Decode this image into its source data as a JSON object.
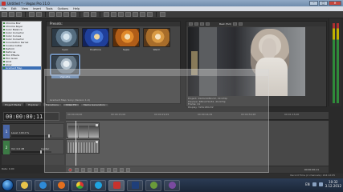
{
  "window": {
    "title": "Untitled * - Vegas Pro 11.0",
    "minimize": "–",
    "maximize": "□",
    "close": "✕"
  },
  "menu": [
    "File",
    "Edit",
    "View",
    "Insert",
    "Tools",
    "Options",
    "Help"
  ],
  "explorer": {
    "items": [
      "Chroma Blur",
      "Chroma Keyer",
      "Color Balance",
      "Color Corrector",
      "Color Curves",
      "Color Corrector",
      "Convolution Kernel",
      "Cookie Cutter",
      "Deform",
      "Defocus",
      "Film Effects",
      "Film Grain",
      "Glint",
      "Glow",
      "Gradient Map"
    ],
    "selected_index": 14
  },
  "bottom_tabs": [
    "Project Media",
    "Explorer",
    "Transitions",
    "Video FX",
    "Media Generators"
  ],
  "plugins": {
    "header": "Presets:",
    "thumbs": [
      "Cyan",
      "Dualtone",
      "Sepia",
      "Warm"
    ],
    "selected": "Vignette",
    "status": "Gradient Map: Sony (Version 1.0)"
  },
  "preview": {
    "quality": "Best (Full)",
    "info_lines": [
      "Project: 1920x1080x32, 29.970p",
      "Preview: 480x270x32, 29.970p",
      "Frame: 11",
      "Display: 320x180x32"
    ]
  },
  "timeline": {
    "timecode": "00:00:00;11",
    "video_track": {
      "number": "1",
      "level": "Level: 100.0 %"
    },
    "audio_track": {
      "number": "2",
      "vol": "Vol: 0.0 dB",
      "pan": "Center"
    },
    "ruler_marks": [
      "00:00:00;00",
      "00:00:15;00",
      "00:00:29;29",
      "00:00:44;29",
      "00:00:59;28",
      "00:01:15;00"
    ],
    "rate": "Rate: 0.00",
    "end_timecode": "00:00:00;11",
    "status": "Record Time (2 channels): 244:12:05"
  },
  "taskbar": {
    "language": "EN",
    "time": "10:32",
    "date": "3.12.2012"
  }
}
